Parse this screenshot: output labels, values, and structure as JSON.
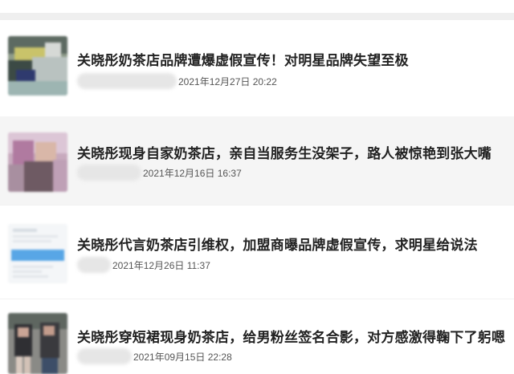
{
  "articles": [
    {
      "title": "关晓彤奶茶店品牌遭爆虚假宣传！对明星品牌失望至极",
      "date": "2021年12月27日 20:22",
      "thumbnail_icon": "blurred-photo-thumbnail"
    },
    {
      "title": "关晓彤现身自家奶茶店，亲自当服务生没架子，路人被惊艳到张大嘴",
      "date": "2021年12月16日 16:37",
      "thumbnail_icon": "blurred-photo-thumbnail"
    },
    {
      "title": "关晓彤代言奶茶店引维权，加盟商曝品牌虚假宣传，求明星给说法",
      "date": "2021年12月26日 11:37",
      "thumbnail_icon": "blurred-screenshot-thumbnail"
    },
    {
      "title": "关晓彤穿短裙现身奶茶店，给男粉丝签名合影，对方感激得鞠下了躬嗯",
      "date": "2021年09月15日 22:28",
      "thumbnail_icon": "blurred-photo-thumbnail"
    }
  ],
  "colors": {
    "title": "#222222",
    "meta": "#555555",
    "alt_row_bg": "#f5f5f5",
    "band": "#efefef"
  }
}
